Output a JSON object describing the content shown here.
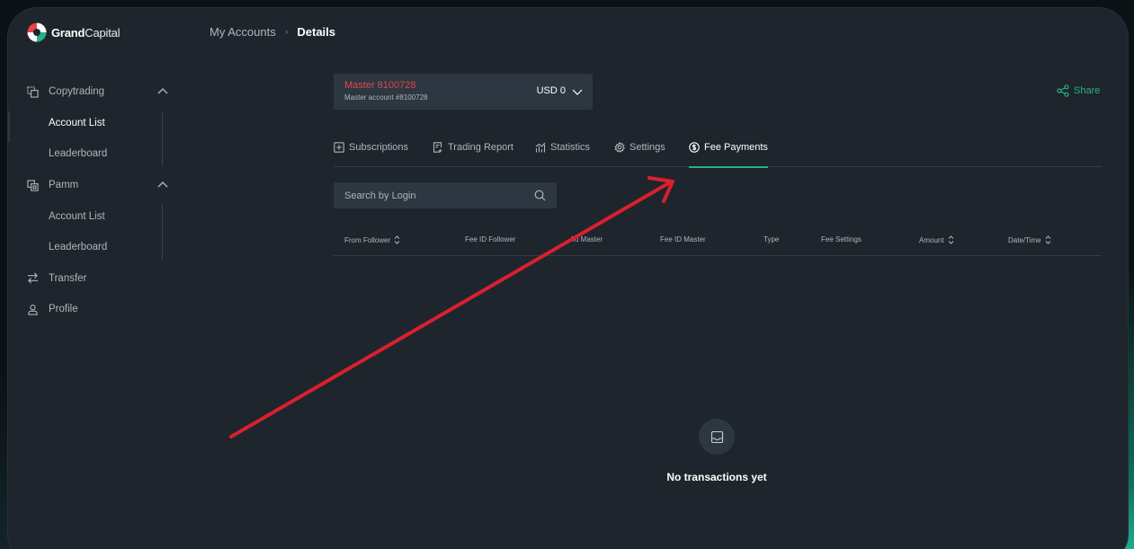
{
  "brand": {
    "name_bold": "Grand",
    "name_light": "Capital"
  },
  "breadcrumb": {
    "parent": "My Accounts",
    "separator": "›",
    "current": "Details"
  },
  "sidebar": {
    "copytrading": {
      "label": "Copytrading",
      "items": [
        {
          "label": "Account List",
          "active": true
        },
        {
          "label": "Leaderboard"
        }
      ]
    },
    "pamm": {
      "label": "Pamm",
      "items": [
        {
          "label": "Account List"
        },
        {
          "label": "Leaderboard"
        }
      ]
    },
    "transfer": {
      "label": "Transfer"
    },
    "profile": {
      "label": "Profile"
    }
  },
  "account": {
    "name": "Master 8100728",
    "subtitle": "Master account #8100728",
    "balance": "USD 0"
  },
  "share": {
    "label": "Share"
  },
  "tabs": [
    {
      "label": "Subscriptions",
      "icon": "plus-square-icon"
    },
    {
      "label": "Trading Report",
      "icon": "report-icon"
    },
    {
      "label": "Statistics",
      "icon": "chart-icon"
    },
    {
      "label": "Settings",
      "icon": "gear-icon"
    },
    {
      "label": "Fee Payments",
      "icon": "dollar-circle-icon",
      "active": true
    }
  ],
  "search": {
    "placeholder": "Search by Login"
  },
  "table": {
    "columns": [
      {
        "label": "From Follower",
        "sortable": true
      },
      {
        "label": "Fee ID Follower",
        "sortable": false
      },
      {
        "label": "To Master",
        "sortable": false
      },
      {
        "label": "Fee ID Master",
        "sortable": false
      },
      {
        "label": "Type",
        "sortable": false
      },
      {
        "label": "Fee Settings",
        "sortable": false
      },
      {
        "label": "Amount",
        "sortable": true
      },
      {
        "label": "Date/Time",
        "sortable": true
      }
    ]
  },
  "empty_state": {
    "message": "No transactions yet",
    "icon": "inbox-icon"
  },
  "colors": {
    "accent": "#25b28d",
    "account_name": "#e2454b",
    "annotation_arrow": "#d8202f"
  }
}
